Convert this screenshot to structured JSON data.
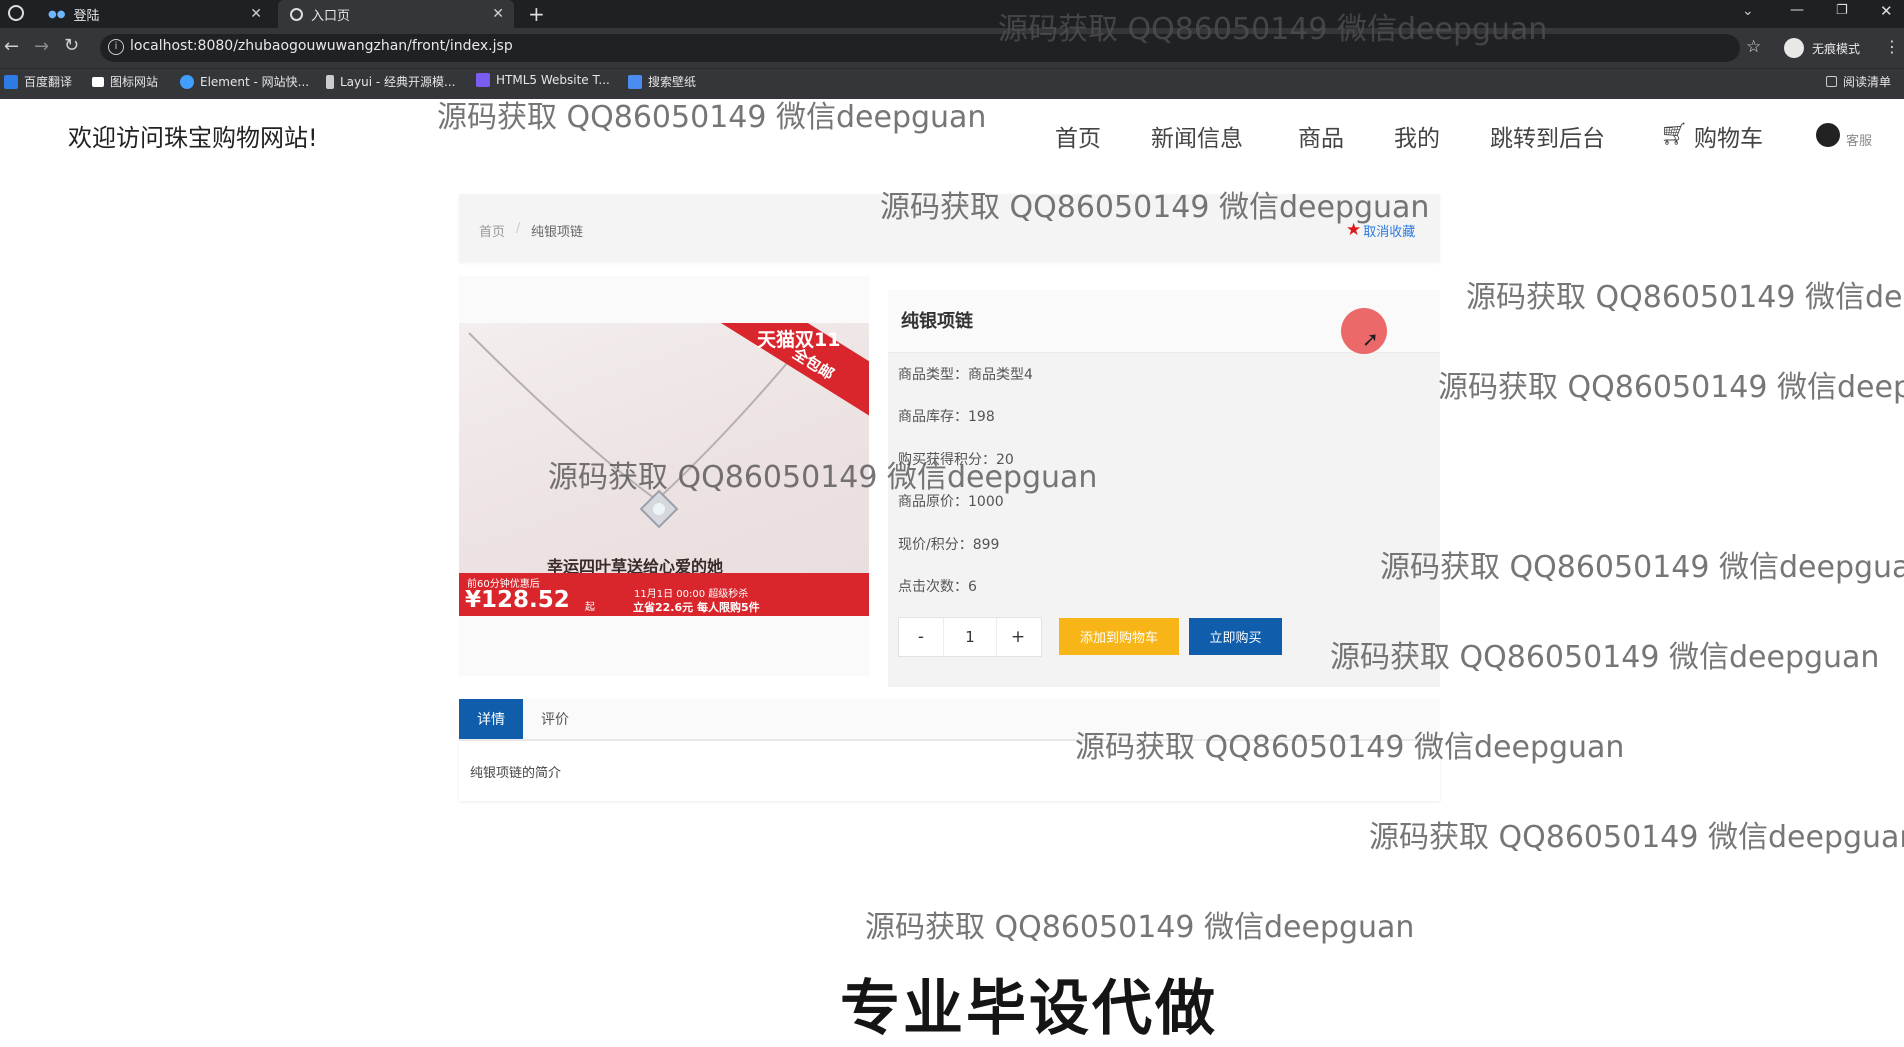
{
  "browser": {
    "tabs": [
      {
        "label": "登陆",
        "active": false
      },
      {
        "label": "入口页",
        "active": true
      }
    ],
    "new_tab": "+",
    "url": "localhost:8080/zhubaogouwuwangzhan/front/index.jsp",
    "profile_label": "无痕模式",
    "bookmarks": [
      {
        "label": "百度翻译",
        "icon": "translate-icon",
        "color": "#2e7be6"
      },
      {
        "label": "图标网站",
        "icon": "bookmark-icon",
        "color": "#ffffff"
      },
      {
        "label": "Element - 网站快...",
        "icon": "element-icon",
        "color": "#409eff"
      },
      {
        "label": "Layui - 经典开源模...",
        "icon": "layui-icon",
        "color": "#cccccc"
      },
      {
        "label": "HTML5 Website T...",
        "icon": "html5-icon",
        "color": "#7a5cf0"
      },
      {
        "label": "搜索壁纸",
        "icon": "wallpaper-icon",
        "color": "#4a8cf0"
      }
    ],
    "reading_list": "阅读清单"
  },
  "header": {
    "welcome": "欢迎访问珠宝购物网站!",
    "nav": [
      "首页",
      "新闻信息",
      "商品",
      "我的",
      "跳转到后台",
      "购物车"
    ],
    "service": "客服"
  },
  "breadcrumb": {
    "home": "首页",
    "separator": "/",
    "current": "纯银项链",
    "favorite": "取消收藏"
  },
  "image": {
    "badge_line1": "天猫双11",
    "badge_line2": "全包邮",
    "slogan": "幸运四叶草送给心爱的她",
    "promo": "前60分钟优惠后",
    "price": "¥128.52",
    "price_suffix": "起",
    "event_line1": "11月1日 00:00 超级秒杀",
    "event_line2": "立省22.6元 每人限购5件"
  },
  "product": {
    "title": "纯银项链",
    "fields": [
      {
        "label": "商品类型",
        "value": "商品类型4"
      },
      {
        "label": "商品库存",
        "value": "198"
      },
      {
        "label": "购买获得积分",
        "value": "20"
      },
      {
        "label": "商品原价",
        "value": "1000"
      },
      {
        "label": "现价/积分",
        "value": "899"
      },
      {
        "label": "点击次数",
        "value": "6"
      }
    ],
    "quantity": {
      "minus": "-",
      "value": "1",
      "plus": "+"
    },
    "add_to_cart": "添加到购物车",
    "buy_now": "立即购买"
  },
  "tabs": [
    {
      "label": "详情",
      "active": true
    },
    {
      "label": "评价",
      "active": false
    }
  ],
  "detail_text": "纯银项链的简介",
  "watermark": "源码获取 QQ86050149 微信deepguan",
  "footer_banner": "专业毕设代做",
  "colors": {
    "primary": "#0f5dab",
    "cart_button": "#f7b518",
    "favorite_star": "#e01515",
    "image_red": "#d8262c"
  }
}
